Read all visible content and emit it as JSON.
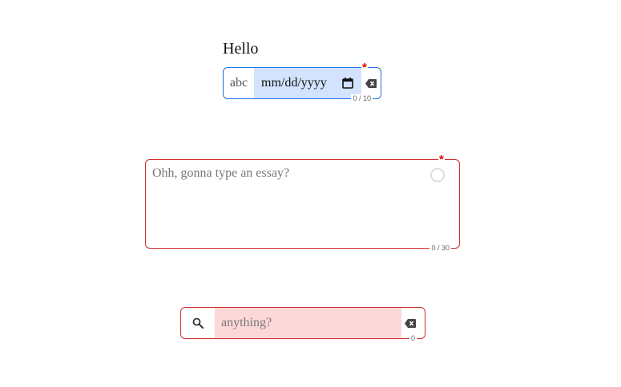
{
  "date_field": {
    "label": "Hello",
    "prefix": "abc",
    "value_placeholder": "mm/dd/yyyy",
    "required_marker": "*",
    "counter": "0 / 10",
    "icons": [
      "calendar-icon",
      "backspace-clear-icon"
    ],
    "border_color": "#1a73e8",
    "highlight_color": "#d3e3fd"
  },
  "essay_field": {
    "placeholder": "Ohh, gonna type an essay?",
    "required_marker": "*",
    "counter": "0 / 30",
    "icons": [
      "loading-spinner-icon"
    ],
    "border_color": "#d32f2f"
  },
  "search_field": {
    "placeholder": "anything?",
    "counter": "0",
    "icons": [
      "search-icon",
      "backspace-clear-icon"
    ],
    "border_color": "#d32f2f",
    "highlight_color": "#fdd8d8"
  }
}
